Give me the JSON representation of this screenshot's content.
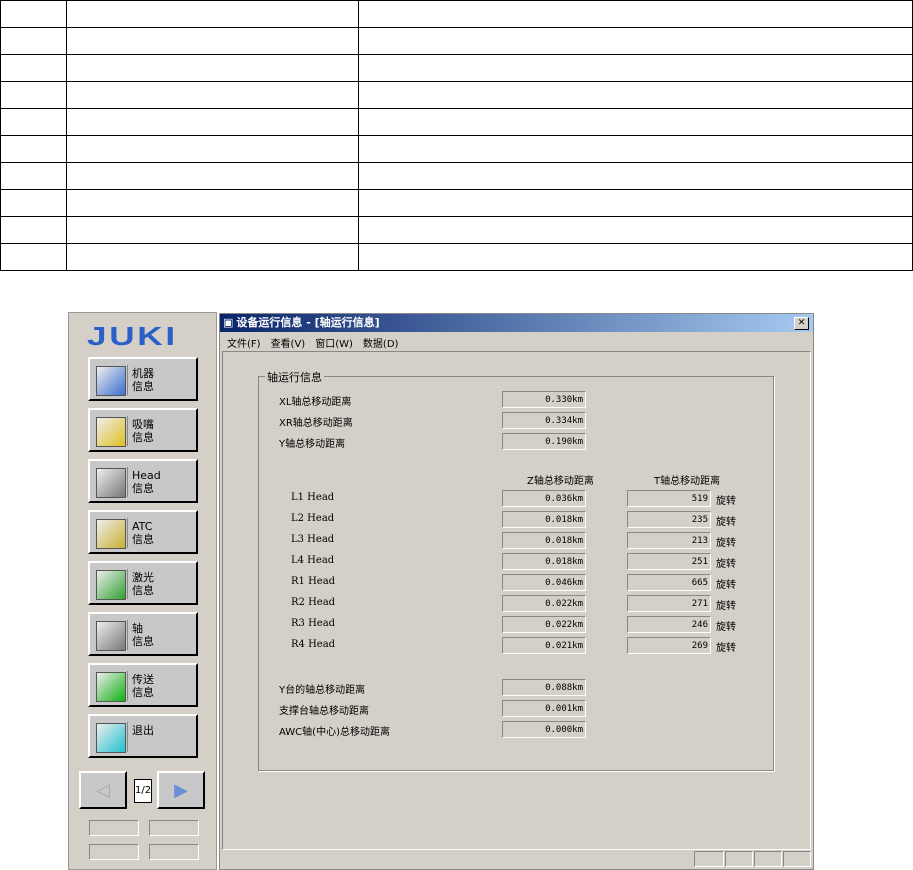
{
  "left_panel": {
    "logo": "JUKI",
    "buttons": [
      {
        "label": "机器\n信息",
        "icon": "machine-info-icon"
      },
      {
        "label": "吸嘴\n信息",
        "icon": "nozzle-info-icon"
      },
      {
        "label": "Head\n信息",
        "icon": "head-info-icon"
      },
      {
        "label": "ATC\n信息",
        "icon": "atc-info-icon"
      },
      {
        "label": "激光\n信息",
        "icon": "laser-info-icon"
      },
      {
        "label": "轴\n信息",
        "icon": "axis-info-icon"
      },
      {
        "label": "传送\n信息",
        "icon": "conveyor-info-icon"
      },
      {
        "label": "退出",
        "icon": "exit-door-icon"
      }
    ],
    "page": "1/2"
  },
  "window": {
    "title": "设备运行信息 - [轴运行信息]",
    "close": "✕",
    "menu": [
      "文件(F)",
      "查看(V)",
      "窗口(W)",
      "数据(D)"
    ],
    "group_title": "轴运行信息",
    "top_rows": [
      {
        "label": "XL轴总移动距离",
        "value": "0.330km"
      },
      {
        "label": "XR轴总移动距离",
        "value": "0.334km"
      },
      {
        "label": "Y轴总移动距离",
        "value": "0.190km"
      }
    ],
    "col_z": "Z轴总移动距离",
    "col_t": "T轴总移动距离",
    "rot_unit": "旋转",
    "heads": [
      {
        "name": "L1 Head",
        "z": "0.036km",
        "t": "519"
      },
      {
        "name": "L2 Head",
        "z": "0.018km",
        "t": "235"
      },
      {
        "name": "L3 Head",
        "z": "0.018km",
        "t": "213"
      },
      {
        "name": "L4 Head",
        "z": "0.018km",
        "t": "251"
      },
      {
        "name": "R1 Head",
        "z": "0.046km",
        "t": "665"
      },
      {
        "name": "R2 Head",
        "z": "0.022km",
        "t": "271"
      },
      {
        "name": "R3 Head",
        "z": "0.022km",
        "t": "246"
      },
      {
        "name": "R4 Head",
        "z": "0.021km",
        "t": "269"
      }
    ],
    "bottom_rows": [
      {
        "label": "Y台的轴总移动距离",
        "value": "0.088km"
      },
      {
        "label": "支撑台轴总移动距离",
        "value": "0.001km"
      },
      {
        "label": "AWC轴(中心)总移动距离",
        "value": "0.000km"
      }
    ]
  }
}
